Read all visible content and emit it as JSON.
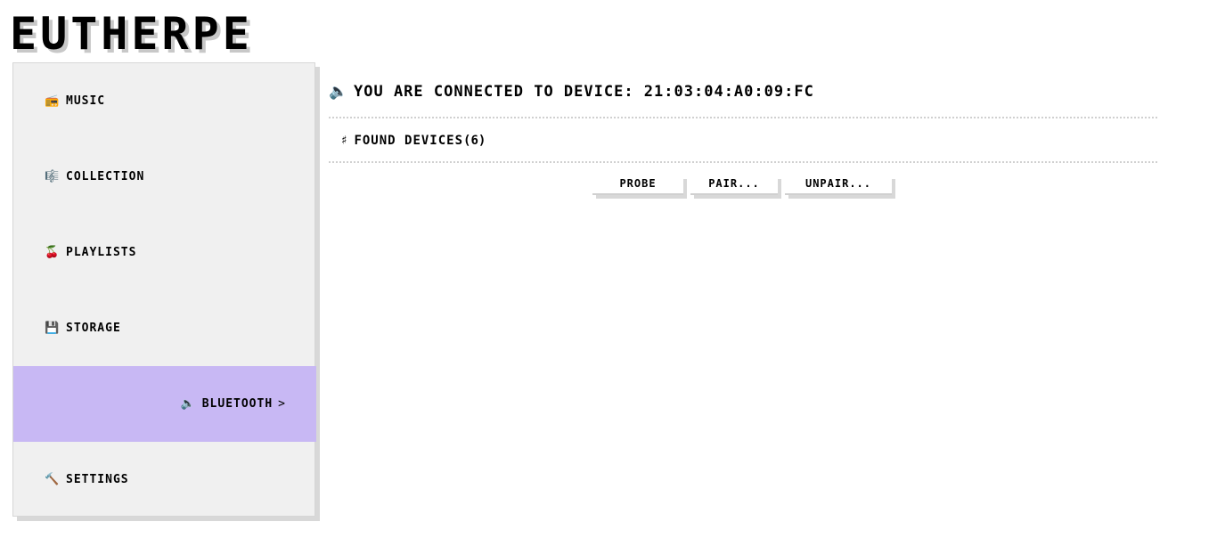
{
  "app": {
    "title": "EUTHERPE"
  },
  "sidebar": {
    "items": [
      {
        "label": "MUSIC",
        "icon": "radio-icon",
        "glyph": "📻"
      },
      {
        "label": "COLLECTION",
        "icon": "music-notes-icon",
        "glyph": "🎼"
      },
      {
        "label": "PLAYLISTS",
        "icon": "cherries-icon",
        "glyph": "🍒"
      },
      {
        "label": "STORAGE",
        "icon": "floppy-disk-icon",
        "glyph": "💾"
      },
      {
        "label": "BLUETOOTH",
        "icon": "speaker-icon",
        "glyph": "🔈",
        "active": true,
        "chevron": ">"
      },
      {
        "label": "SETTINGS",
        "icon": "hammer-icon",
        "glyph": "🔨"
      }
    ]
  },
  "main": {
    "header": {
      "icon": "speaker-icon",
      "glyph": "🔈",
      "text": "YOU ARE CONNECTED TO DEVICE: 21:03:04:A0:09:FC"
    },
    "devices": {
      "hash": "♯",
      "label": "FOUND DEVICES",
      "count": "(6)"
    },
    "buttons": {
      "probe": "PROBE",
      "pair": "PAIR...",
      "unpair": "UNPAIR..."
    }
  },
  "colors": {
    "accent": "#c8b8f4",
    "sidebar_bg": "#f0f0f0",
    "shadow": "#d8d8d8"
  }
}
